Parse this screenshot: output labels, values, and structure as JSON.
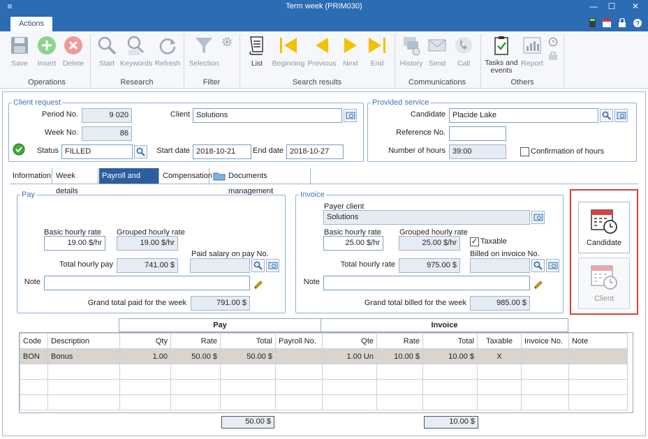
{
  "window": {
    "title": "Term week (PRIM030)"
  },
  "tabs": {
    "actions": "Actions"
  },
  "ribbon": {
    "save": "Save",
    "insert": "Insert",
    "delete": "Delete",
    "start": "Start",
    "keywords": "Keywords",
    "refresh": "Refresh",
    "selection": "Selection",
    "list": "List",
    "beginning": "Beginning",
    "previous": "Previous",
    "next": "Next",
    "end": "End",
    "history": "History",
    "send": "Send",
    "call": "Call",
    "tasks_line1": "Tasks and",
    "tasks_line2": "events",
    "report": "Report",
    "groups": {
      "operations": "Operations",
      "research": "Research",
      "filter": "Filter",
      "search_results": "Search results",
      "communications": "Communications",
      "others": "Others"
    }
  },
  "client_request": {
    "legend": "Client request",
    "period_label": "Period No.",
    "period": "9 020",
    "week_label": "Week No.",
    "week": "86",
    "status_label": "Status",
    "status": "FILLED",
    "client_label": "Client",
    "client": "Solutions",
    "start_label": "Start date",
    "start": "2018-10-21",
    "end_label": "End date",
    "end": "2018-10-27"
  },
  "provided_service": {
    "legend": "Provided service",
    "candidate_label": "Candidate",
    "candidate": "Placide Lake",
    "reference_label": "Reference No.",
    "reference": "",
    "hours_label": "Number of hours",
    "hours": "39:00",
    "confirm_label": "Confirmation of hours"
  },
  "detail_tabs": {
    "information": "Information",
    "week_details": "Week details",
    "payroll": "Payroll and Billing",
    "compensation": "Compensation",
    "documents": "Documents management"
  },
  "pay": {
    "legend": "Pay",
    "basic_label": "Basic hourly rate",
    "basic": "19.00 $/hr",
    "grouped_label": "Grouped hourly rate",
    "grouped": "19.00 $/hr",
    "total_label": "Total hourly pay",
    "total": "741.00 $",
    "paid_label": "Paid salary on pay No.",
    "paid": "",
    "note_label": "Note",
    "note": "",
    "grand_label": "Grand total paid for the week",
    "grand": "791.00 $"
  },
  "invoice": {
    "legend": "Invoice",
    "payer_label": "Payer client",
    "payer": "Solutions",
    "basic_label": "Basic hourly rate",
    "basic": "25.00 $/hr",
    "grouped_label": "Grouped hourly rate",
    "grouped": "25.00 $/hr",
    "taxable_label": "Taxable",
    "total_label": "Total hourly rate",
    "total": "975.00 $",
    "billed_label": "Billed on invoice No.",
    "billed": "",
    "note_label": "Note",
    "note": "",
    "grand_label": "Grand total billed for the week",
    "grand": "985.00 $"
  },
  "side_buttons": {
    "candidate": "Candidate",
    "client": "Client"
  },
  "grid": {
    "group_pay": "Pay",
    "group_invoice": "Invoice",
    "headers": [
      "Code",
      "Description",
      "Qty",
      "Rate",
      "Total",
      "Payroll No.",
      "Qte",
      "Rate",
      "Total",
      "Taxable",
      "Invoice No.",
      "Note"
    ],
    "rows": [
      [
        "BON",
        "Bonus",
        "1.00",
        "50.00 $",
        "50.00 $",
        "",
        "1.00 Un",
        "10.00 $",
        "10.00 $",
        "X",
        "",
        ""
      ]
    ],
    "pay_total": "50.00 $",
    "invoice_total": "10.00 $"
  },
  "colors": {
    "accent": "#2b6cb3",
    "highlight": "#e03a3a"
  }
}
